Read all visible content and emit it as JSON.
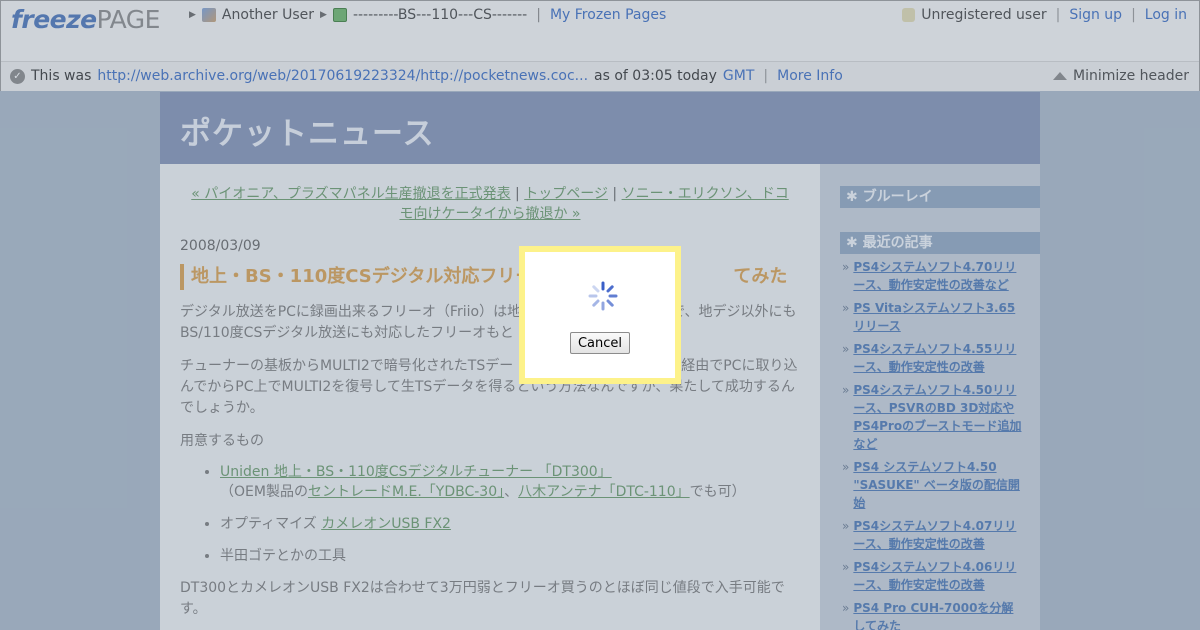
{
  "freezepage": {
    "logo_freeze": "freeze",
    "logo_page": "PAGE",
    "breadcrumb_user": "Another User",
    "breadcrumb_page": "---------BS---110---CS-------",
    "my_pages": "My Frozen Pages",
    "user_status": "Unregistered user",
    "sign_up": "Sign up",
    "log_in": "Log in",
    "info_prefix": "This was",
    "archived_url": "http://web.archive.org/web/20170619223324/http://pocketnews.coc...",
    "info_time": "as of 03:05 today",
    "timezone": "GMT",
    "more_info": "More Info",
    "minimize": "Minimize header",
    "separator": "|"
  },
  "site": {
    "title": "ポケットニュース",
    "nav_prev": "« パイオニア、プラズマパネル生産撤退を正式発表",
    "nav_top": "トップページ",
    "nav_next": "ソニー・エリクソン、ドコモ向けケータイから撤退か »",
    "nav_sep": "|",
    "date": "2008/03/09",
    "post_title": "地上・BS・110度CSデジタル対応フリー",
    "post_title_tail": "てみた",
    "para1": "デジタル放送をPCに録画出来るフリーオ（Friio）は地",
    "para1_tail": "で、地デジ以外にもBS/110度CSデジタル放送にも対応したフリーオもと",
    "para2": "チューナーの基板からMULTI2で暗号化されたTSデー",
    "para2_mid": "ード経由でPCに取り込んでからPC上でMULTI2を復号して生TSデータを得るという方法なんですが、果たして成功するんでしょうか。",
    "prep_heading": "用意するもの",
    "item1_link": "Uniden 地上・BS・110度CSデジタルチューナー 「DT300」",
    "item1_sub_prefix": "（OEM製品の",
    "item1_sub_link1": "セントレードM.E.「YDBC-30」",
    "item1_sub_sep": "、",
    "item1_sub_link2": "八木アンテナ「DTC-110」",
    "item1_sub_suffix": "でも可）",
    "item2_prefix": "オプティマイズ ",
    "item2_link": "カメレオンUSB FX2",
    "item3": "半田ゴテとかの工具",
    "para3": "DT300とカメレオンUSB FX2は合わせて3万円弱とフリーオ買うのとほぼ同じ値段で入手可能です。"
  },
  "sidebar": {
    "heading1": "✱ ブルーレイ",
    "heading2": "✱ 最近の記事",
    "bullet": "»",
    "articles": [
      "PS4システムソフト4.70リリース、動作安定性の改善など",
      "PS Vitaシステムソフト3.65リリース",
      "PS4システムソフト4.55リリース、動作安定性の改善",
      "PS4システムソフト4.50リリース、PSVRのBD 3D対応やPS4Proのブーストモード追加など",
      "PS4 システムソフト4.50 \"SASUKE\" ベータ版の配信開始",
      "PS4システムソフト4.07リリース、動作安定性の改善",
      "PS4システムソフト4.06リリース、動作安定性の改善",
      "PS4 Pro CUH-7000を分解してみた"
    ]
  },
  "dialog": {
    "cancel_label": "Cancel"
  },
  "colors": {
    "logo_blue": "#4a73b8",
    "link_blue": "#3b6cc2",
    "banner": "#8392b5",
    "post_title": "#d9a050",
    "dialog_border": "#fdf28a",
    "spinner": "#3a5fc8"
  }
}
